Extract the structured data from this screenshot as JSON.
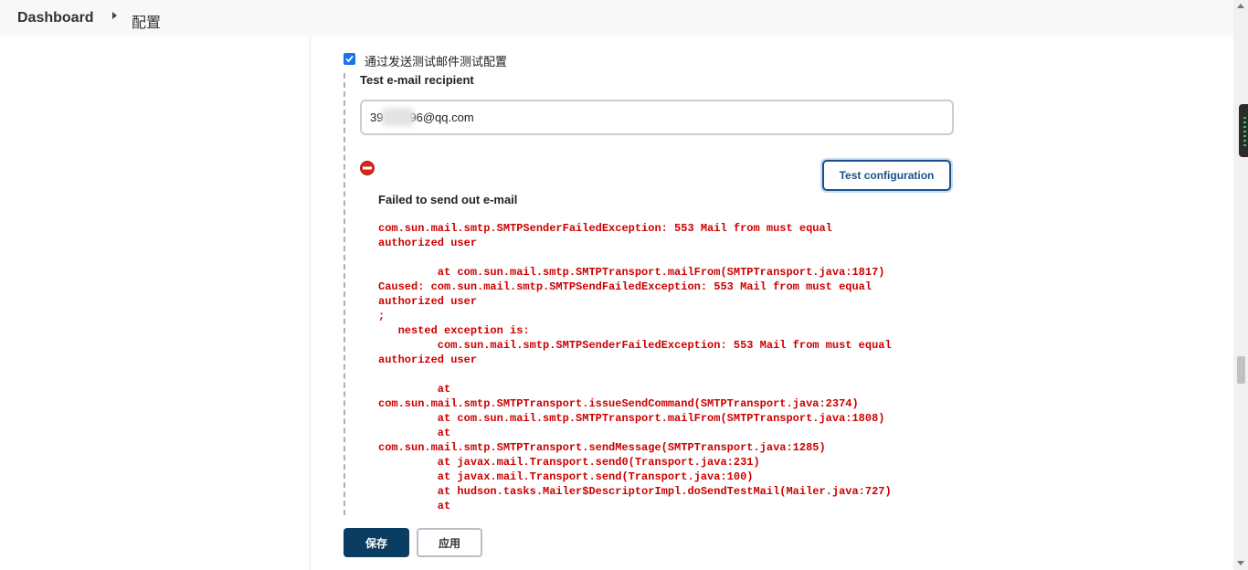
{
  "breadcrumb": {
    "dashboard": "Dashboard",
    "current": "配置"
  },
  "email_test": {
    "checkbox_label": "通过发送测试邮件测试配置",
    "checked": true,
    "recipient_label": "Test e-mail recipient",
    "recipient_value": "39      196@qq.com",
    "test_button": "Test configuration"
  },
  "result": {
    "title": "Failed to send out e-mail",
    "stacktrace": "com.sun.mail.smtp.SMTPSenderFailedException: 553 Mail from must equal\nauthorized user\n\n         at com.sun.mail.smtp.SMTPTransport.mailFrom(SMTPTransport.java:1817)\nCaused: com.sun.mail.smtp.SMTPSendFailedException: 553 Mail from must equal\nauthorized user\n;\n   nested exception is:\n         com.sun.mail.smtp.SMTPSenderFailedException: 553 Mail from must equal\nauthorized user\n\n         at\ncom.sun.mail.smtp.SMTPTransport.issueSendCommand(SMTPTransport.java:2374)\n         at com.sun.mail.smtp.SMTPTransport.mailFrom(SMTPTransport.java:1808)\n         at\ncom.sun.mail.smtp.SMTPTransport.sendMessage(SMTPTransport.java:1285)\n         at javax.mail.Transport.send0(Transport.java:231)\n         at javax.mail.Transport.send(Transport.java:100)\n         at hudson.tasks.Mailer$DescriptorImpl.doSendTestMail(Mailer.java:727)\n         at",
    "error_color": "#cc0000"
  },
  "actions": {
    "save": "保存",
    "apply": "应用"
  },
  "colors": {
    "primary": "#0b3d62",
    "accent": "#1c4f8a",
    "error": "#cc0000"
  }
}
